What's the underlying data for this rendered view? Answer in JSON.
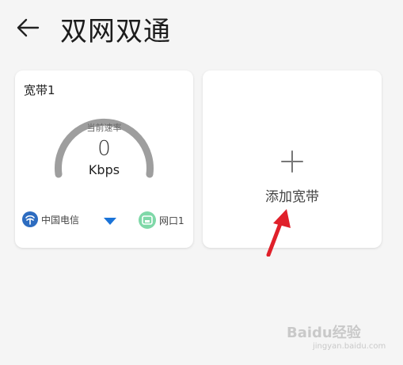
{
  "header": {
    "title": "双网双通",
    "back_icon": "arrow-left-icon"
  },
  "broadband_card": {
    "label": "宽带1",
    "speed_label": "当前速率",
    "speed_value": "0",
    "speed_unit": "Kbps",
    "isp_name": "中国电信",
    "port_name": "网口1",
    "colors": {
      "gauge": "#9e9e9e",
      "isp_icon": "#2d6cc0",
      "port_icon": "#7fd8a8",
      "dropdown": "#1a73d8"
    }
  },
  "add_card": {
    "label": "添加宽带",
    "icon": "plus-icon"
  },
  "annotation": {
    "color": "#e0202a"
  },
  "watermark": {
    "text": "Baidu经验",
    "sub": "jingyan.baidu.com"
  }
}
